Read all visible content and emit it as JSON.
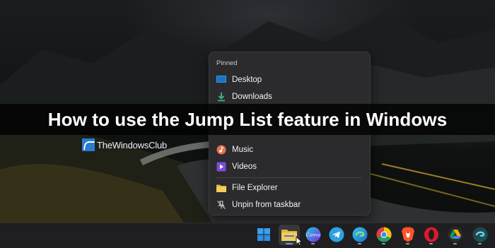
{
  "banner": {
    "title": "How to use the Jump List feature in Windows"
  },
  "brand": {
    "name": "TheWindowsClub"
  },
  "jumplist": {
    "header": "Pinned",
    "items": [
      {
        "label": "Desktop",
        "icon": "desktop-folder-icon"
      },
      {
        "label": "Downloads",
        "icon": "downloads-icon"
      },
      {
        "label": "Music",
        "icon": "music-icon"
      },
      {
        "label": "Videos",
        "icon": "videos-icon"
      }
    ],
    "actions": [
      {
        "label": "File Explorer",
        "icon": "file-explorer-icon"
      },
      {
        "label": "Unpin from taskbar",
        "icon": "unpin-icon"
      }
    ]
  },
  "taskbar": {
    "icons": [
      "start-icon",
      "file-explorer-icon",
      "canva-icon",
      "telegram-icon",
      "edge-icon",
      "chrome-icon",
      "brave-icon",
      "opera-icon",
      "google-drive-icon",
      "edge-dev-icon"
    ],
    "canva_label": "Canva"
  },
  "colors": {
    "accent": "#5aa8ff",
    "menu_bg": "#2b2b2d",
    "taskbar_bg": "#1f1f21"
  }
}
